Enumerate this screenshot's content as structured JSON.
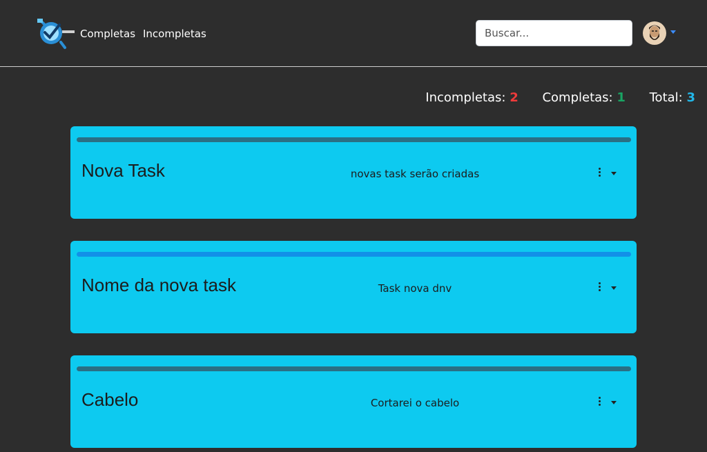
{
  "nav": {
    "logo_icon": "checklist-logo-icon",
    "links": [
      "Completas",
      "Incompletas"
    ]
  },
  "search": {
    "placeholder": "Buscar..."
  },
  "user": {
    "avatar_icon": "bearded-man-avatar-icon",
    "caret_icon": "caret-down-icon"
  },
  "counters": {
    "incomplete_label": "Incompletas:",
    "incomplete_value": "2",
    "complete_label": "Completas:",
    "complete_value": "1",
    "total_label": "Total:",
    "total_value": "3"
  },
  "colors": {
    "background": "#2d2d2d",
    "card": "#0dcaf0",
    "incomplete": "#ef3b3b",
    "complete": "#19a463",
    "total": "#22b7e8"
  },
  "tasks": [
    {
      "title": "Nova Task",
      "description": "novas task serão criadas",
      "completed": false
    },
    {
      "title": "Nome da nova task",
      "description": "Task nova dnv",
      "completed": true
    },
    {
      "title": "Cabelo",
      "description": "Cortarei o cabelo",
      "completed": false
    }
  ]
}
